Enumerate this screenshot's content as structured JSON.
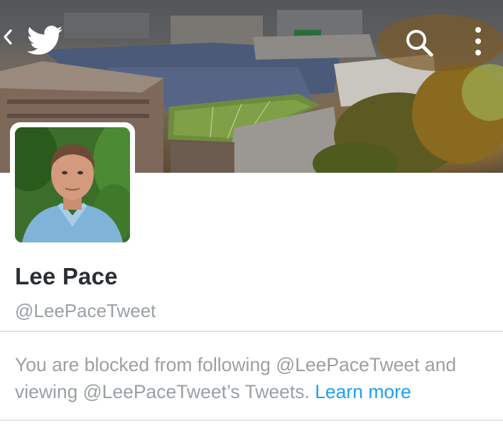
{
  "header": {
    "back_icon": "chevron-left-icon",
    "logo_icon": "twitter-bird-icon",
    "search_icon": "search-icon",
    "menu_icon": "more-vertical-icon",
    "banner": "stadium-aerial-photo"
  },
  "profile": {
    "name": "Lee Pace",
    "handle": "@LeePaceTweet",
    "avatar": "profile-photo"
  },
  "notice": {
    "message": "You are blocked from following @LeePaceTweet and viewing @LeePaceTweet’s Tweets. ",
    "link_label": "Learn more"
  },
  "colors": {
    "link": "#1da1f2",
    "name_text": "#292f33",
    "muted_text": "#9aa0a4",
    "divider": "#e1e4e6"
  }
}
